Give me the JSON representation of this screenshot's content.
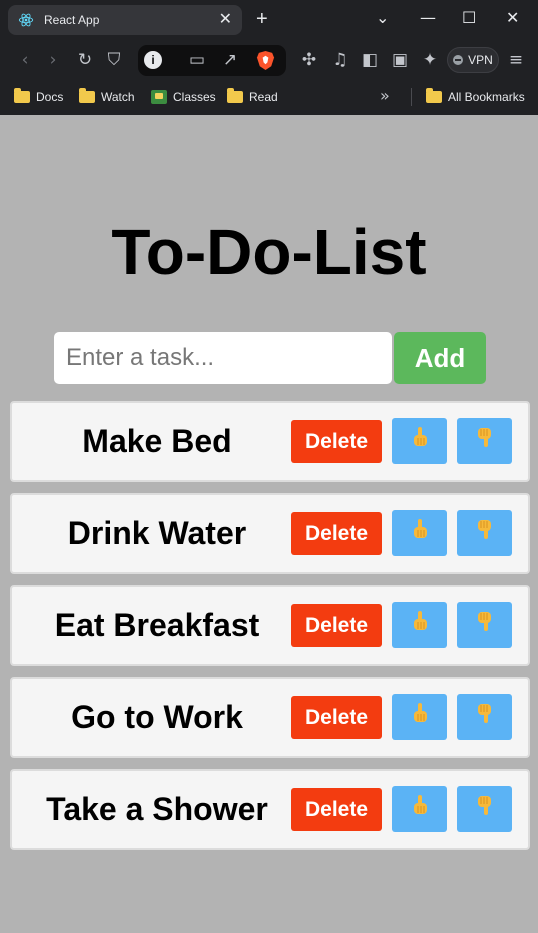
{
  "browser": {
    "tab_title": "React App",
    "tab_close": "✕",
    "new_tab": "+",
    "vpn_label": "VPN",
    "bookmarks": [
      {
        "label": "Docs",
        "icon": "folder-icon"
      },
      {
        "label": "Watch",
        "icon": "folder-icon"
      },
      {
        "label": "Classes",
        "icon": "classes-icon"
      },
      {
        "label": "Read",
        "icon": "folder-icon"
      }
    ],
    "all_bookmarks": "All Bookmarks",
    "more": "»"
  },
  "app": {
    "title": "To-Do-List",
    "input_placeholder": "Enter a task...",
    "add_label": "Add",
    "delete_label": "Delete",
    "tasks": [
      {
        "name": "Make Bed"
      },
      {
        "name": "Drink Water"
      },
      {
        "name": "Eat Breakfast"
      },
      {
        "name": "Go to Work"
      },
      {
        "name": "Take a Shower"
      }
    ]
  },
  "colors": {
    "page_bg": "#b3b3b3",
    "add_button": "#5cb85c",
    "delete_button": "#f33c10",
    "move_button": "#5bb3f5",
    "hand_emoji": "#f6b93b"
  }
}
